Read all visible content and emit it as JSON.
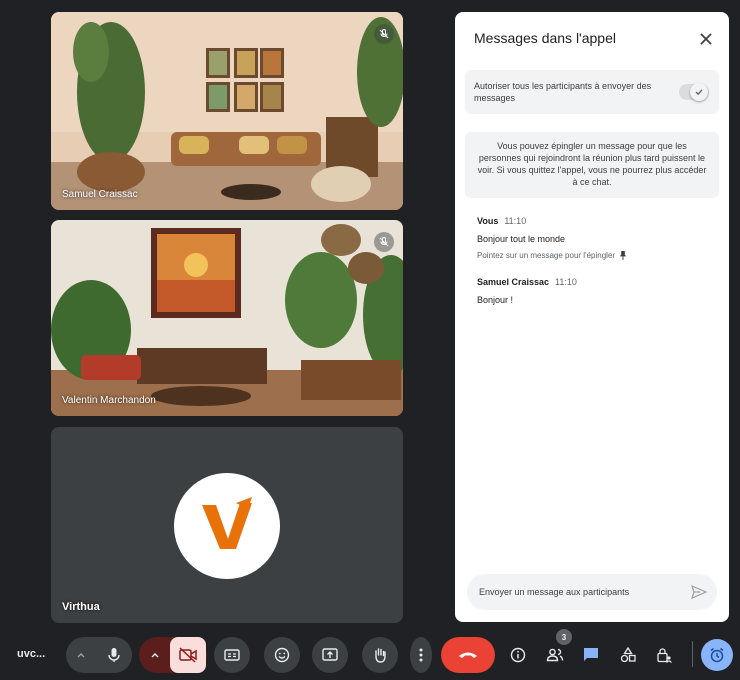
{
  "participants": [
    {
      "name": "Samuel Craissac",
      "muted": true
    },
    {
      "name": "Valentin Marchandon",
      "muted": true
    },
    {
      "name": "Virthua",
      "avatar_initial": "V",
      "avatar_color": "#e8710a"
    }
  ],
  "chat_panel": {
    "title": "Messages dans l'appel",
    "toggle_label": "Autoriser tous les participants à envoyer des messages",
    "toggle_on": true,
    "info_text": "Vous pouvez épingler un message pour que les personnes qui rejoindront la réunion plus tard puissent le voir. Si vous quittez l'appel, vous ne pourrez plus accéder à ce chat.",
    "messages": [
      {
        "sender": "Vous",
        "time": "11:10",
        "text": "Bonjour tout le monde",
        "hint": "Pointez sur un message pour l'épingler"
      },
      {
        "sender": "Samuel Craissac",
        "time": "11:10",
        "text": "Bonjour !"
      }
    ],
    "input_placeholder": "Envoyer un message aux participants"
  },
  "toolbar": {
    "meeting_code": "uvc...",
    "participant_count": "3",
    "end_call_color": "#ea4335",
    "accent_color": "#8ab4f8"
  }
}
